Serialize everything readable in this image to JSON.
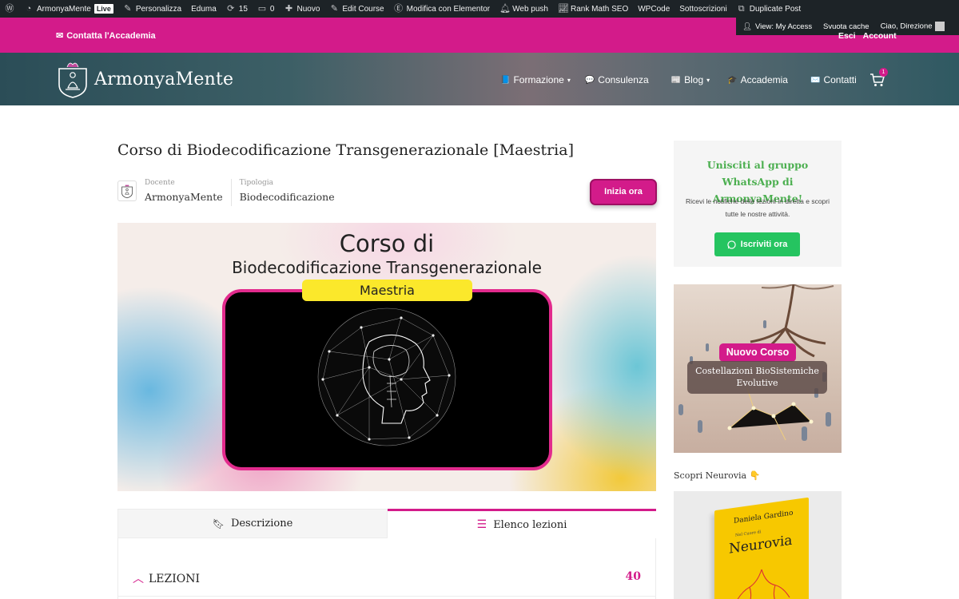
{
  "admin_bar": {
    "site_name": "ArmonyaMente",
    "live": "Live",
    "customize": "Personalizza",
    "theme": "Eduma",
    "updates": "15",
    "comments": "0",
    "new": "Nuovo",
    "edit_course": "Edit Course",
    "elementor": "Modifica con Elementor",
    "web_push": "Web push",
    "rank_math": "Rank Math SEO",
    "wpcode": "WPCode",
    "subscriptions": "Sottoscrizioni",
    "duplicate": "Duplicate Post",
    "view_access": "View: My Access",
    "clear_cache": "Svuota cache",
    "greeting": "Ciao, Direzione"
  },
  "topbar": {
    "contact": "Contatta l'Accademia",
    "logout": "Esci",
    "account": "Account"
  },
  "header": {
    "logo_text": "ArmonyaMente",
    "nav": [
      {
        "emoji": "📘",
        "label": "Formazione",
        "has_dropdown": true
      },
      {
        "emoji": "💬",
        "label": "Consulenza",
        "has_dropdown": false
      },
      {
        "emoji": "📰",
        "label": "Blog",
        "has_dropdown": true
      },
      {
        "emoji": "🎓",
        "label": "Accademia",
        "has_dropdown": false
      },
      {
        "emoji": "✉️",
        "label": "Contatti",
        "has_dropdown": false
      }
    ],
    "cart_count": "1"
  },
  "course": {
    "title": "Corso di Biodecodificazione Transgenerazionale [Maestria]",
    "teacher_label": "Docente",
    "teacher": "ArmonyaMente",
    "type_label": "Tipologia",
    "type": "Biodecodificazione",
    "start_button": "Inizia ora",
    "banner": {
      "line1": "Corso di",
      "line2": "Biodecodificazione Transgenerazionale",
      "pill": "Maestria"
    },
    "tabs": [
      {
        "label": "Descrizione",
        "active": false
      },
      {
        "label": "Elenco lezioni",
        "active": true
      }
    ],
    "lessons_label": "LEZIONI",
    "lessons_count": "40"
  },
  "sidebar": {
    "whatsapp": {
      "title": "Unisciti al gruppo WhatsApp di ArmonyaMente!",
      "text": "Ricevi le notifiche delle lezioni in diretta e scopri tutte le nostre attività.",
      "button": "Iscriviti ora"
    },
    "promo": {
      "badge": "Nuovo Corso",
      "subtitle": "Costellazioni BioSistemiche Evolutive"
    },
    "neurovia_label": "Scopri Neurovia 👇",
    "book": {
      "author": "Daniela Gardino",
      "subtitle": "Nel Cuore di",
      "title": "Neurovia"
    }
  },
  "colors": {
    "accent": "#d31b8a",
    "admin_bar": "#1d2327",
    "whatsapp_green": "#25c460"
  }
}
